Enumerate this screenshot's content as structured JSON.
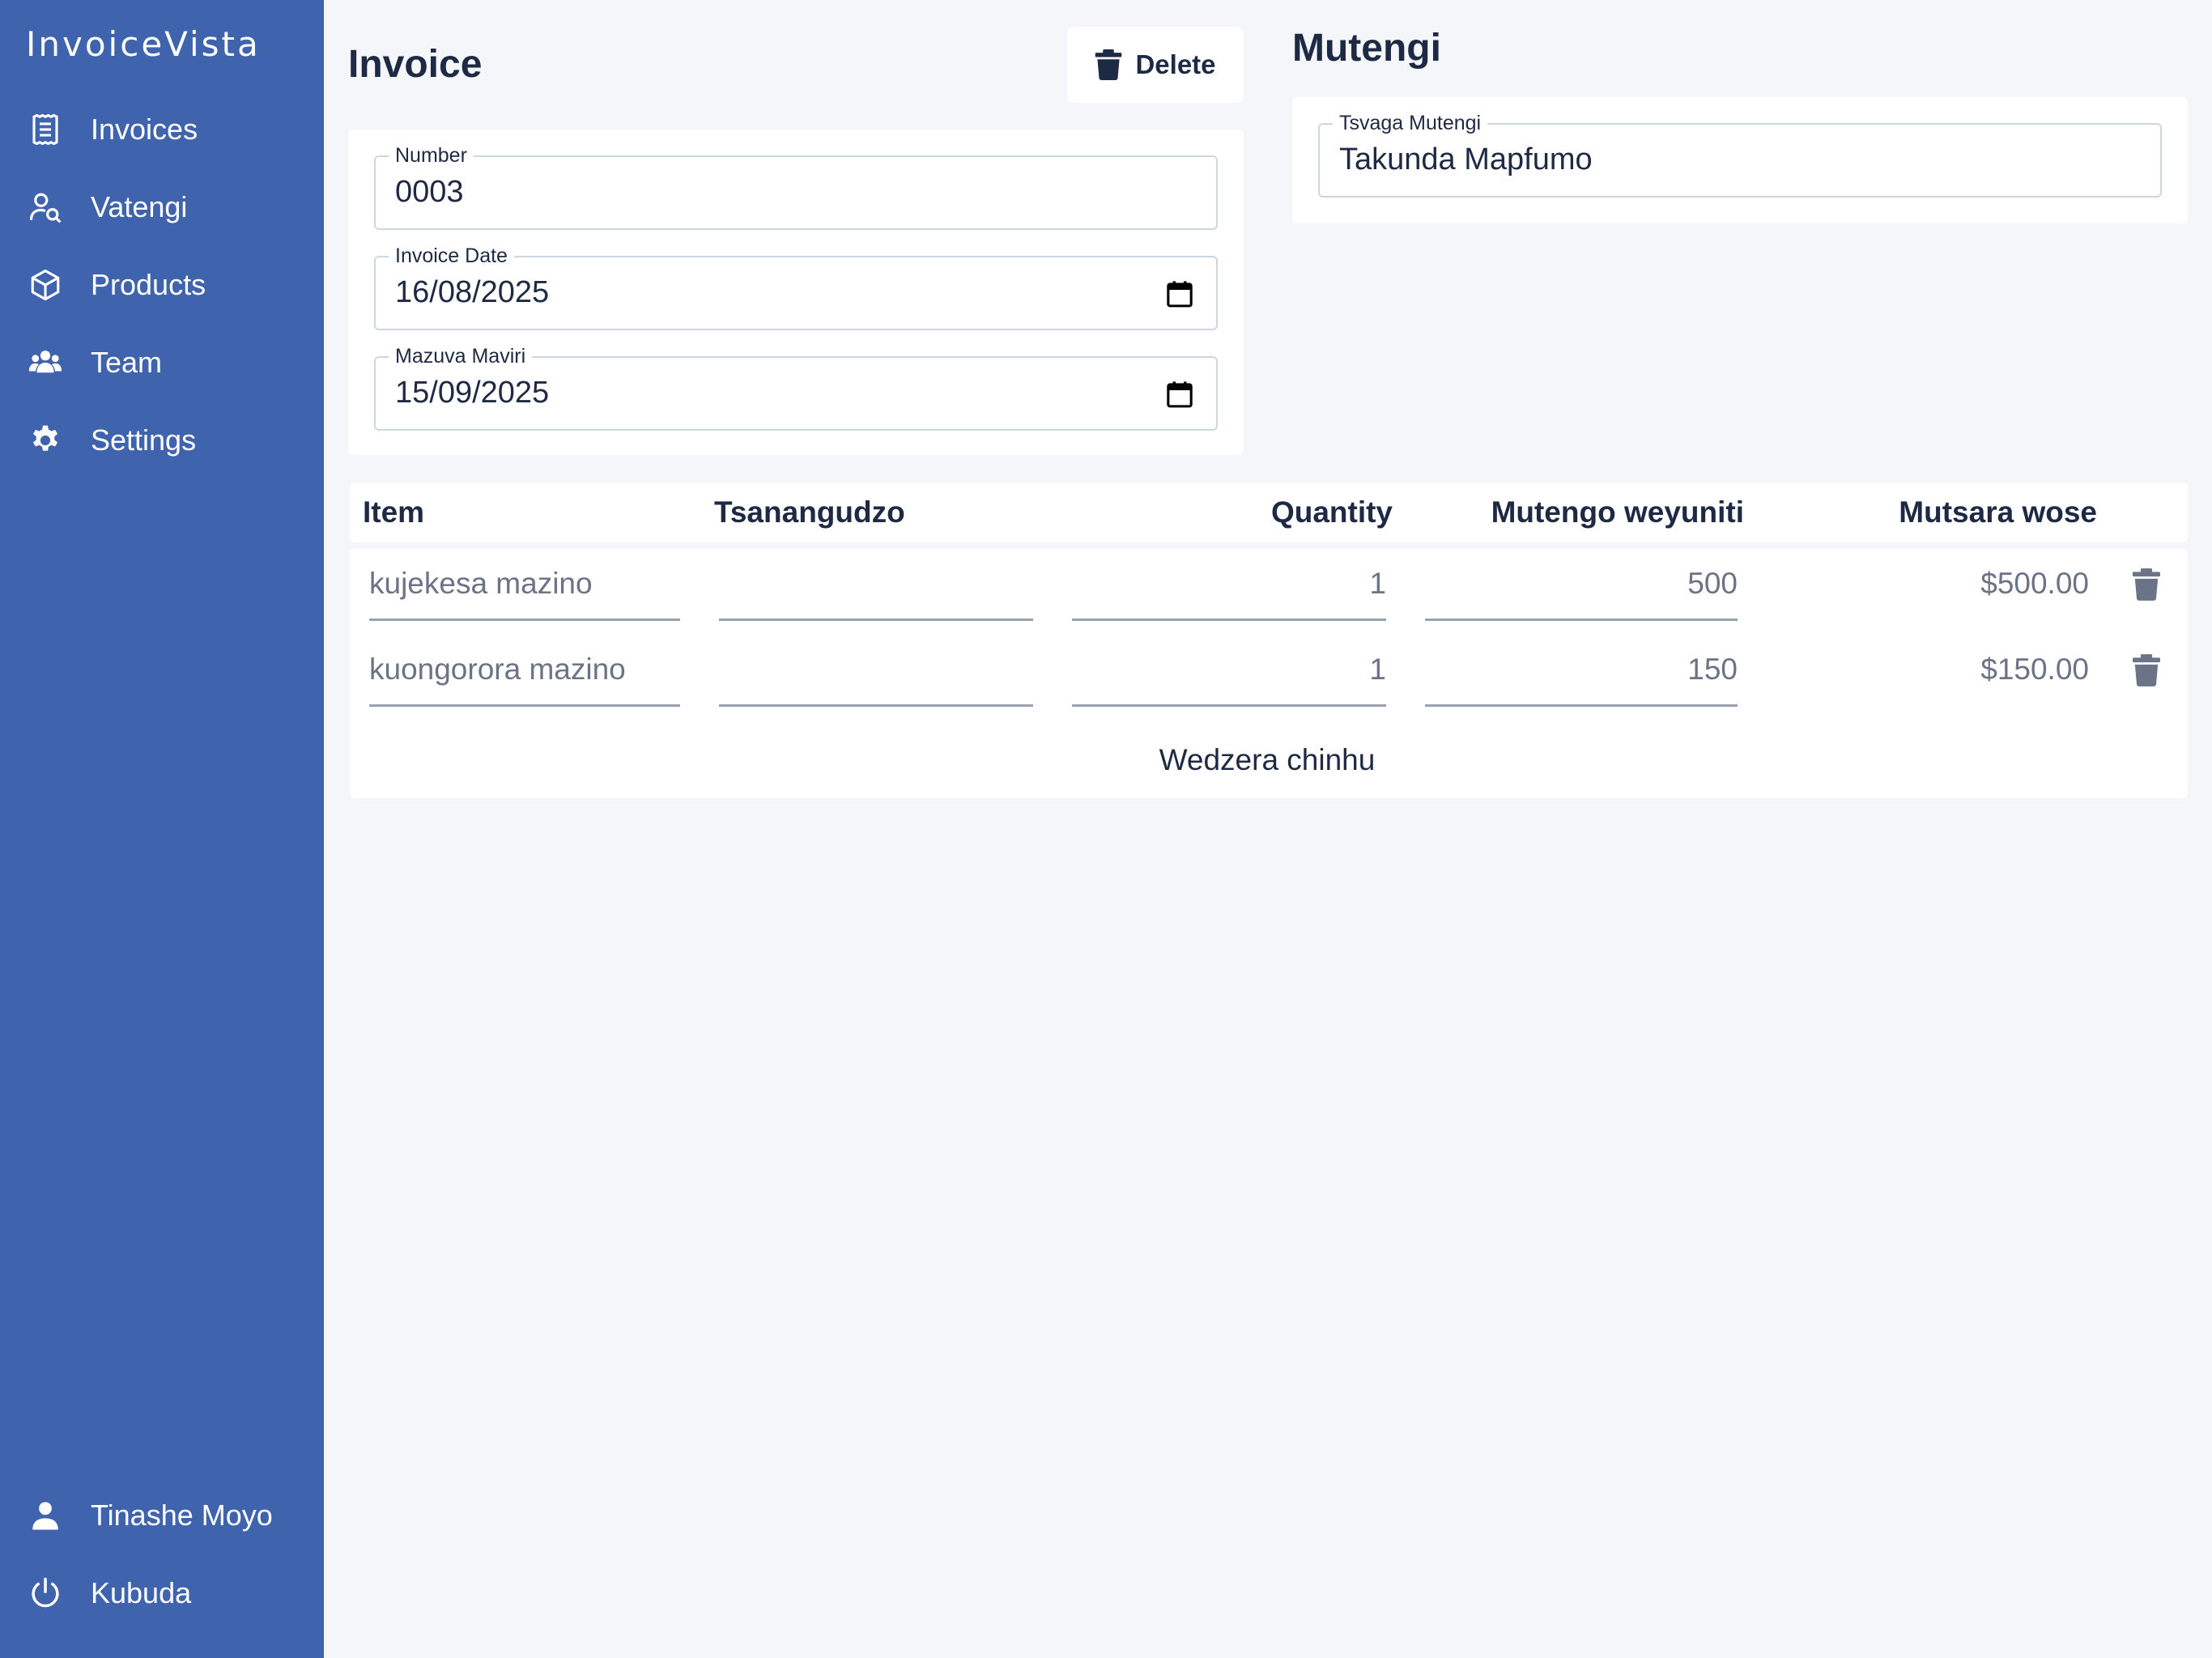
{
  "app": {
    "brand": "InvoiceVista"
  },
  "sidebar": {
    "items": [
      {
        "label": "Invoices",
        "icon": "invoice-list-icon"
      },
      {
        "label": "Vatengi",
        "icon": "user-search-icon"
      },
      {
        "label": "Products",
        "icon": "cube-icon"
      },
      {
        "label": "Team",
        "icon": "team-icon"
      },
      {
        "label": "Settings",
        "icon": "gear-icon"
      }
    ],
    "user": {
      "label": "Tinashe Moyo",
      "icon": "user-icon"
    },
    "logout": {
      "label": "Kubuda",
      "icon": "power-icon"
    }
  },
  "invoice": {
    "title": "Invoice",
    "delete_label": "Delete",
    "number": {
      "label": "Number",
      "value": "0003"
    },
    "invoice_date": {
      "label": "Invoice Date",
      "value": "16/08/2025"
    },
    "due_date": {
      "label": "Mazuva Maviri",
      "value": "15/09/2025"
    }
  },
  "customer": {
    "title": "Mutengi",
    "search": {
      "label": "Tsvaga Mutengi",
      "value": "Takunda Mapfumo"
    }
  },
  "table": {
    "headers": [
      "Item",
      "Tsanangudzo",
      "Quantity",
      "Mutengo weyuniti",
      "Mutsara wose"
    ],
    "rows": [
      {
        "item": "kujekesa mazino",
        "description": "",
        "quantity": "1",
        "unit_price": "500",
        "total": "$500.00"
      },
      {
        "item": "kuongorora mazino",
        "description": "",
        "quantity": "1",
        "unit_price": "150",
        "total": "$150.00"
      }
    ],
    "add_item_label": "Wedzera chinhu"
  },
  "colors": {
    "sidebar": "#3f63ad",
    "background": "#f4f6fa",
    "text": "#1e2a44",
    "muted": "#6b7387"
  }
}
